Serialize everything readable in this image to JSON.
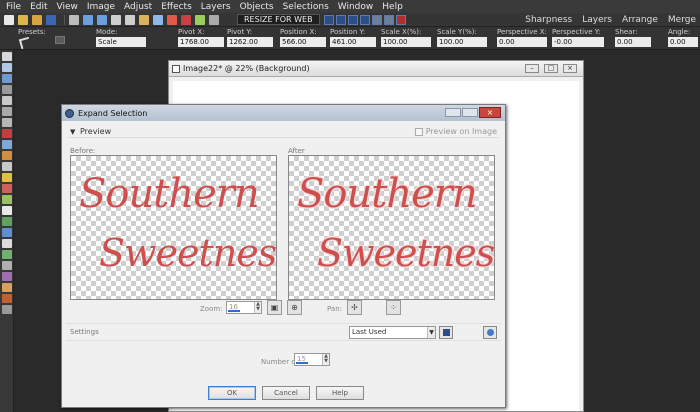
{
  "menu": [
    "File",
    "Edit",
    "View",
    "Image",
    "Adjust",
    "Effects",
    "Layers",
    "Objects",
    "Selections",
    "Window",
    "Help"
  ],
  "toolbar": {
    "resize_label": "RESIZE FOR WEB",
    "right_menus": [
      "Sharpness",
      "Layers",
      "Arrange",
      "Merge"
    ]
  },
  "tool_options": {
    "presets_label": "Presets:",
    "mode_label": "Mode:",
    "mode_value": "Scale",
    "fields": [
      {
        "label": "Pivot X:",
        "value": "1768.00"
      },
      {
        "label": "Pivot Y:",
        "value": "1262.00"
      },
      {
        "label": "Position X:",
        "value": "566.00"
      },
      {
        "label": "Position Y:",
        "value": "461.00"
      },
      {
        "label": "Scale X(%):",
        "value": "100.00"
      },
      {
        "label": "Scale Y(%):",
        "value": "100.00"
      },
      {
        "label": "Perspective X:",
        "value": "0.00"
      },
      {
        "label": "Perspective Y:",
        "value": "-0.00"
      },
      {
        "label": "Shear:",
        "value": "0.00"
      },
      {
        "label": "Angle:",
        "value": "0.00"
      }
    ]
  },
  "image_window": {
    "title": "Image22* @  22% (Background)"
  },
  "dialog": {
    "title": "Expand Selection",
    "preview_label": "Preview",
    "preview_on_image": "Preview on Image",
    "before_label": "Before:",
    "after_label": "After",
    "preview_text_line1": "Southern",
    "preview_text_line2": "Sweetness",
    "zoom_label": "Zoom:",
    "zoom_value": "16",
    "pan_label": "Pan:",
    "settings_label": "Settings",
    "settings_value": "Last Used",
    "pixels_label": "Number of pixels:",
    "pixels_value": "15",
    "ok_label": "OK",
    "cancel_label": "Cancel",
    "help_label": "Help"
  },
  "colors": {
    "text_red": "#cf4f4f",
    "dialog_bg": "#f0f0f0",
    "app_bg": "#2a2a2a"
  }
}
